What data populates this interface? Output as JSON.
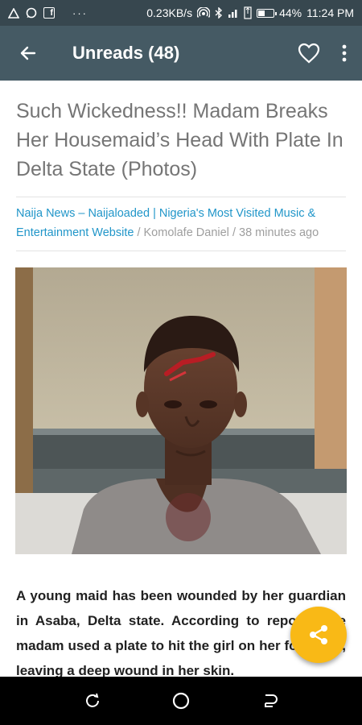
{
  "status_bar": {
    "net_speed": "0.23KB/s",
    "battery_percent": "44%",
    "battery_level": 0.44,
    "time": "11:24 PM",
    "icons": [
      "alert-icon",
      "chat-icon",
      "facebook-icon",
      "more-notifications-icon",
      "hotspot-icon",
      "bluetooth-icon",
      "signal-icon",
      "data-icon",
      "battery-icon"
    ]
  },
  "app_bar": {
    "title": "Unreads (48)",
    "back_icon": "back-arrow-icon",
    "favorite_icon": "heart-outline-icon",
    "menu_icon": "overflow-menu-icon"
  },
  "article": {
    "title": "Such Wickedness!! Madam Breaks Her Housemaid’s Head With Plate In Delta State (Photos)",
    "source": "Naija News – Naijaloaded | Nigeria's Most Visited Music & Entertainment Website",
    "separator": " / ",
    "author": "Komolafe Daniel",
    "time_ago": "38 minutes ago",
    "body": "A young maid has been wounded by her guardian in Asaba, Delta state. According to reports, the madam used a plate to hit the girl on her forehead, leaving a deep wound in her skin."
  },
  "fab": {
    "icon": "share-icon"
  },
  "colors": {
    "status_bar": "#37474f",
    "app_bar": "#455a64",
    "link": "#2196c9",
    "fab": "#f9b916"
  },
  "nav_bar": {
    "icons": [
      "recent-apps-icon",
      "home-icon",
      "back-nav-icon"
    ]
  }
}
